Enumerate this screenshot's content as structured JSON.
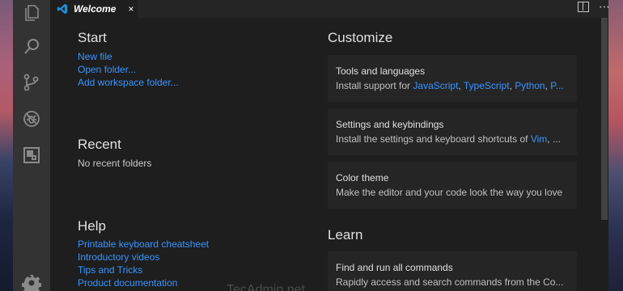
{
  "tab": {
    "label": "Welcome",
    "close": "×"
  },
  "header": {
    "more": "⋯"
  },
  "start": {
    "heading": "Start",
    "links": [
      "New file",
      "Open folder...",
      "Add workspace folder..."
    ]
  },
  "recent": {
    "heading": "Recent",
    "empty": "No recent folders"
  },
  "help": {
    "heading": "Help",
    "links": [
      "Printable keyboard cheatsheet",
      "Introductory videos",
      "Tips and Tricks",
      "Product documentation"
    ]
  },
  "customize": {
    "heading": "Customize",
    "cards": [
      {
        "title": "Tools and languages",
        "desc_prefix": "Install support for ",
        "links": [
          "JavaScript",
          "TypeScript",
          "Python",
          "P..."
        ],
        "separator": ", "
      },
      {
        "title": "Settings and keybindings",
        "desc_prefix": "Install the settings and keyboard shortcuts of ",
        "links": [
          "Vim",
          "..."
        ],
        "separator": ", "
      },
      {
        "title": "Color theme",
        "desc": "Make the editor and your code look the way you love"
      }
    ]
  },
  "learn": {
    "heading": "Learn",
    "cards": [
      {
        "title": "Find and run all commands",
        "desc": "Rapidly access and search commands from the Co..."
      }
    ]
  },
  "watermark": "TecAdmin.net",
  "colors": {
    "accent": "#3794ff",
    "activity_bar": "#333333",
    "editor_bg": "#1e1e1e",
    "card_bg": "#252526"
  },
  "icons": [
    "files-icon",
    "search-icon",
    "source-control-icon",
    "debug-icon",
    "extensions-icon",
    "gear-icon",
    "vscode-logo-icon",
    "split-editor-icon"
  ]
}
